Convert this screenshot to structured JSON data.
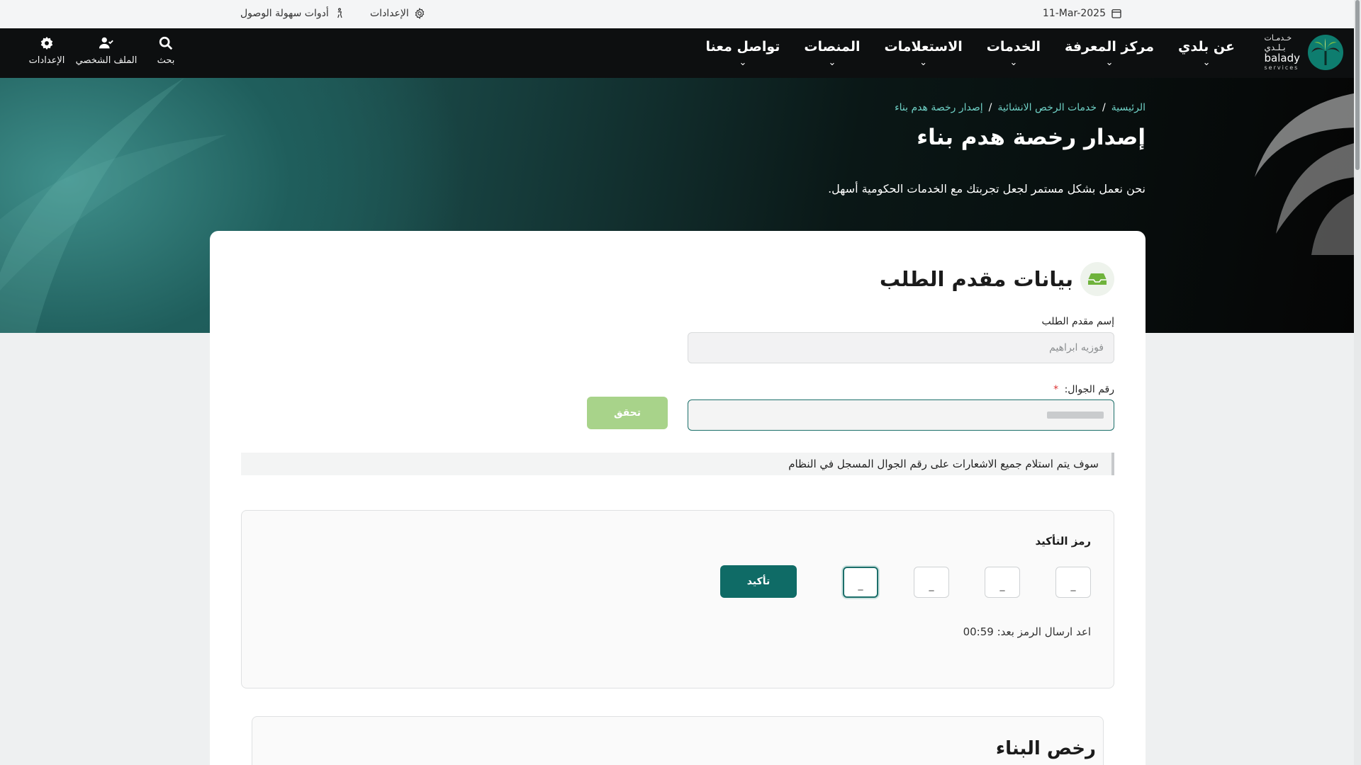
{
  "util_bar": {
    "date": "11-Mar-2025",
    "settings_label": "الإعدادات",
    "accessibility_label": "أدوات سهولة الوصول"
  },
  "logo": {
    "ar_small": "خـدمـات",
    "ar_name": "بـلـدي",
    "en_name": "balady",
    "en_small": "services"
  },
  "nav": {
    "items": [
      {
        "label": "عن بلدي"
      },
      {
        "label": "مركز المعرفة"
      },
      {
        "label": "الخدمات"
      },
      {
        "label": "الاستعلامات"
      },
      {
        "label": "المنصات"
      },
      {
        "label": "تواصل معنا"
      }
    ]
  },
  "header_tools": {
    "search_label": "بحث",
    "profile_label": "الملف الشخصي",
    "settings_label": "الإعدادات"
  },
  "breadcrumb": {
    "home": "الرئيسية",
    "section": "خدمات الرخص الانشائية",
    "current": "إصدار رخصة هدم بناء"
  },
  "hero": {
    "title": "إصدار رخصة هدم بناء",
    "subtitle": "نحن نعمل بشكل مستمر لجعل تجربتك مع الخدمات الحكومية أسهل."
  },
  "applicant": {
    "section_title": "بيانات مقدم الطلب",
    "name_label": "إسم مقدم الطلب",
    "name_value": "فوزيه ابراهيم",
    "mobile_label": "رقم الجوال:",
    "required_mark": "*",
    "verify_button": "تحقق",
    "notice": "سوف يتم استلام جميع الاشعارات على رقم الجوال المسجل في النظام"
  },
  "otp": {
    "title": "رمز التأكيد",
    "digits": [
      "_",
      "_",
      "_",
      "_"
    ],
    "confirm_button": "تأكيد",
    "resend_text": "اعد ارسال الرمز بعد: 00:59"
  },
  "permits": {
    "title": "رخص البناء"
  },
  "colors": {
    "brand_teal": "#0f6b66",
    "verify_disabled": "#a8d38a",
    "link": "#6fd0c5",
    "header_bg": "#0d0f10"
  }
}
